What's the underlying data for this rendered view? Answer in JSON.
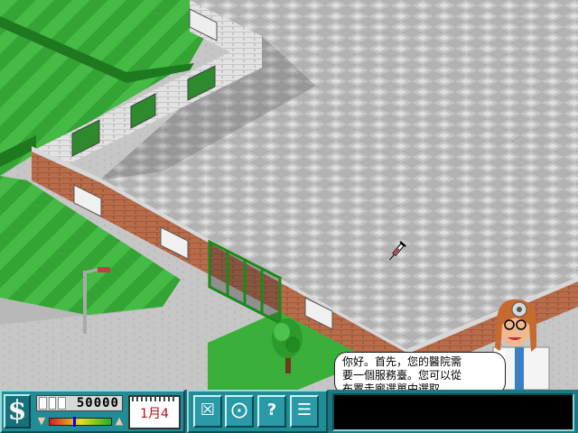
{
  "advisor": {
    "line1": "你好。首先，您的醫院需",
    "line2": "要一個服務臺。您可以從",
    "line3": "布置走廊選單中選取。"
  },
  "hud": {
    "money_value": "50000",
    "calendar_date": "1月4",
    "reputation_fraction": 0.38,
    "tools": [
      {
        "name": "build",
        "icon": "build-icon"
      },
      {
        "name": "map",
        "icon": "compass-icon"
      },
      {
        "name": "help",
        "icon": "question-icon"
      },
      {
        "name": "status",
        "icon": "status-list-icon"
      }
    ]
  },
  "colors": {
    "hud_teal": "#1f8c96",
    "floor": "#b4b4b4",
    "grass": "#3db03d",
    "brick": "#b66a48"
  },
  "icons": {
    "money": "dollar-icon",
    "thumb_down": "thumb-down-icon",
    "thumb_up": "thumb-up-icon",
    "cursor": "syringe-cursor-icon"
  }
}
